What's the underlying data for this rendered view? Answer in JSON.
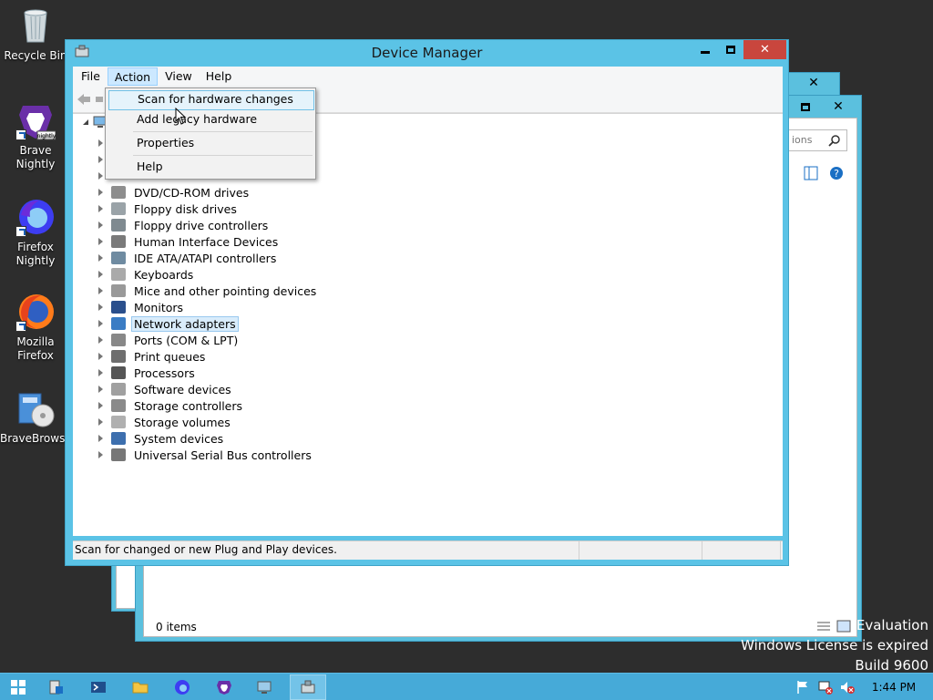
{
  "desktop": {
    "icons": [
      {
        "label": "Recycle Bin"
      },
      {
        "label": "Brave Nightly"
      },
      {
        "label": "Firefox Nightly"
      },
      {
        "label": "Mozilla Firefox"
      },
      {
        "label": "BraveBrows..."
      }
    ],
    "brave_badge": "nightly"
  },
  "window": {
    "title": "Device Manager",
    "menu": [
      "File",
      "Action",
      "View",
      "Help"
    ],
    "active_menu": "Action"
  },
  "action_menu": {
    "items": [
      "Scan for hardware changes",
      "Add legacy hardware",
      "Properties",
      "Help"
    ]
  },
  "tree": {
    "items": [
      "DVD/CD-ROM drives",
      "Floppy disk drives",
      "Floppy drive controllers",
      "Human Interface Devices",
      "IDE ATA/ATAPI controllers",
      "Keyboards",
      "Mice and other pointing devices",
      "Monitors",
      "Network adapters",
      "Ports (COM & LPT)",
      "Print queues",
      "Processors",
      "Software devices",
      "Storage controllers",
      "Storage volumes",
      "System devices",
      "Universal Serial Bus controllers"
    ],
    "selected": "Network adapters"
  },
  "status": {
    "text": "Scan for changed or new Plug and Play devices."
  },
  "background_window": {
    "search_placeholder": "ions",
    "status": "0 items"
  },
  "watermark": {
    "line1": "Evaluation",
    "line2": "Windows License is expired",
    "line3": "Build 9600"
  },
  "taskbar": {
    "clock": "1:44 PM"
  },
  "colors": {
    "accent": "#5bc3e6",
    "taskbar": "#46aad8",
    "close": "#c9463d"
  }
}
